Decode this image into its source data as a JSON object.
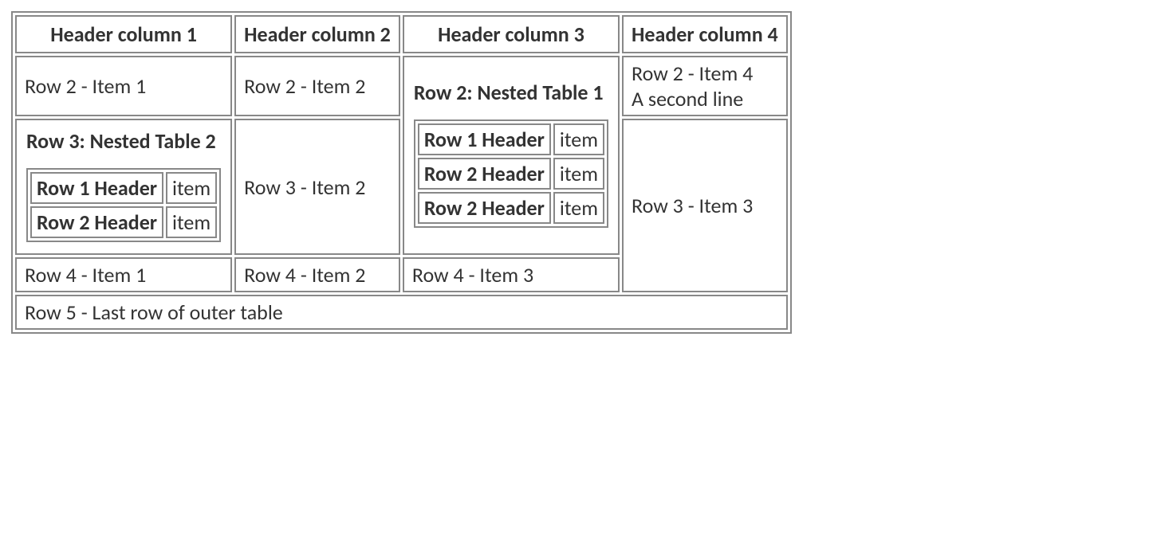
{
  "headers": [
    "Header column 1",
    "Header column 2",
    "Header column 3",
    "Header column 4"
  ],
  "row2": {
    "c1": "Row 2 - Item 1",
    "c2": "Row 2 - Item 2",
    "c4_line1": "Row 2 - Item 4",
    "c4_line2": "A second line"
  },
  "nested1": {
    "title": "Row 2: Nested Table 1",
    "rows": [
      {
        "h": "Row 1 Header",
        "v": "item"
      },
      {
        "h": "Row 2 Header",
        "v": "item"
      },
      {
        "h": "Row 2 Header",
        "v": "item"
      }
    ]
  },
  "row3": {
    "c2": "Row 3 - Item 2",
    "c4": "Row 3 - Item 3"
  },
  "nested2": {
    "title": "Row 3: Nested Table 2",
    "rows": [
      {
        "h": "Row 1 Header",
        "v": "item"
      },
      {
        "h": "Row 2 Header",
        "v": "item"
      }
    ]
  },
  "row4": {
    "c1": "Row 4 - Item 1",
    "c2": "Row 4 - Item 2",
    "c3": "Row 4 - Item 3"
  },
  "row5": "Row 5 - Last row of outer table"
}
